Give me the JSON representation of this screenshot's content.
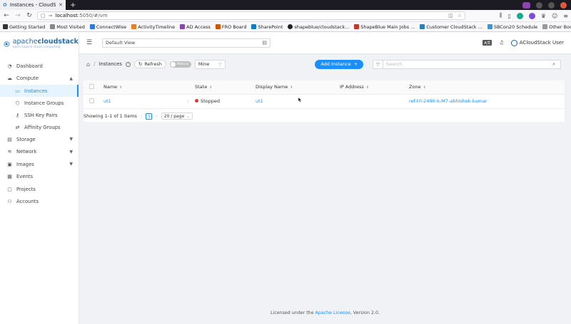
{
  "browser": {
    "tab_title": "Instances - CloudStack",
    "url_host": "localhost",
    "url_rest": ":5050/#/vm"
  },
  "bookmarks": [
    {
      "label": "Getting Started",
      "color": "#333333"
    },
    {
      "label": "Most Visited",
      "color": "#888888"
    },
    {
      "label": "ConnectWise",
      "color": "#2a7ae2"
    },
    {
      "label": "ActivityTimeline",
      "color": "#e67e22"
    },
    {
      "label": "AD Access",
      "color": "#8e44ad"
    },
    {
      "label": "FRO Board",
      "color": "#d35400"
    },
    {
      "label": "SharePoint",
      "color": "#0a7cc4"
    },
    {
      "label": "shapeblue/cloudstack...",
      "color": "#222222"
    },
    {
      "label": "ShapeBlue Main Jobs ...",
      "color": "#c0392b"
    },
    {
      "label": "Customer CloudStack ...",
      "color": "#2980b9"
    },
    {
      "label": "SBCon20 Schedule",
      "color": "#3498db"
    }
  ],
  "bookmarks_other": "Other Bookmarks",
  "logo": {
    "main_bold": "apache",
    "main_light": "cloudstack",
    "sub": "open source cloud computing"
  },
  "sidebar": {
    "items": [
      {
        "label": "Dashboard",
        "icon": "dashboard-icon",
        "glyph": "◔"
      },
      {
        "label": "Compute",
        "icon": "cloud-icon",
        "glyph": "☁"
      },
      {
        "label": "Instances",
        "icon": "desktop-icon",
        "glyph": "▭"
      },
      {
        "label": "Instance Groups",
        "icon": "gold-icon",
        "glyph": "⬡"
      },
      {
        "label": "SSH Key Pairs",
        "icon": "key-icon",
        "glyph": "⚷"
      },
      {
        "label": "Affinity Groups",
        "icon": "swap-icon",
        "glyph": "⇄"
      },
      {
        "label": "Storage",
        "icon": "database-icon",
        "glyph": "▤"
      },
      {
        "label": "Network",
        "icon": "wifi-icon",
        "glyph": "≋"
      },
      {
        "label": "Images",
        "icon": "picture-icon",
        "glyph": "▣"
      },
      {
        "label": "Events",
        "icon": "schedule-icon",
        "glyph": "▦"
      },
      {
        "label": "Projects",
        "icon": "project-icon",
        "glyph": "▢"
      },
      {
        "label": "Accounts",
        "icon": "team-icon",
        "glyph": "⚇"
      }
    ]
  },
  "topbar": {
    "view_select": "Default View",
    "user_name": "ACloudStack User"
  },
  "toolbar": {
    "breadcrumb": "Instances",
    "refresh_label": "Refresh",
    "metrics_label": "Metrics",
    "filter_value": "Mine",
    "add_label": "Add Instance",
    "search_placeholder": "Search"
  },
  "table": {
    "columns": [
      "Name",
      "State",
      "Display Name",
      "IP Address",
      "Zone"
    ],
    "rows": [
      {
        "name": "ut1",
        "state": "Stopped",
        "display_name": "ut1",
        "ip": "",
        "zone": "ref-trl-2490-k-M7-abhishek-kumar"
      }
    ]
  },
  "pagination": {
    "summary": "Showing 1-1 of 1 items",
    "current_page": "1",
    "page_size": "20 / page"
  },
  "footer": {
    "prefix": "Licensed under the ",
    "link": "Apache License",
    "suffix": ", Version 2.0."
  },
  "colors": {
    "accent": "#1890ff",
    "stopped": "#e8362c",
    "brand": "#2d6ca2"
  }
}
